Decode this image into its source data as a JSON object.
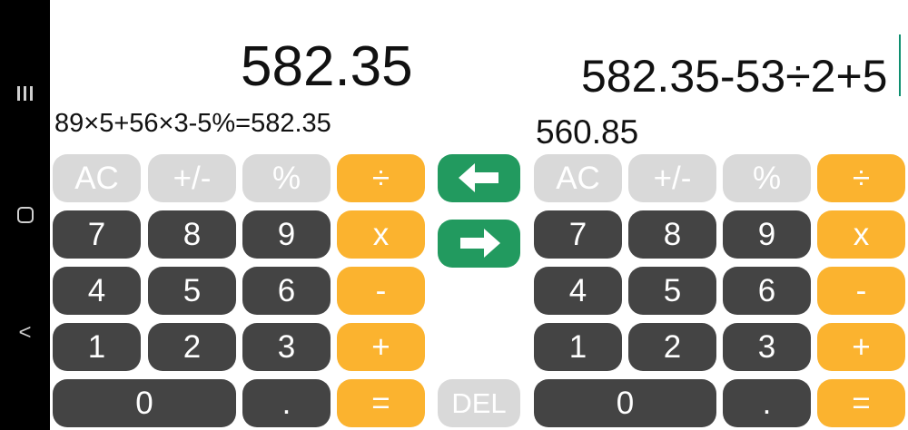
{
  "left_panel": {
    "display": "582.35",
    "history": "89×5+56×3-5%=582.35",
    "keys": {
      "ac": "AC",
      "plusminus": "+/-",
      "percent": "%",
      "divide": "÷",
      "seven": "7",
      "eight": "8",
      "nine": "9",
      "multiply": "x",
      "four": "4",
      "five": "5",
      "six": "6",
      "minus": "-",
      "one": "1",
      "two": "2",
      "three": "3",
      "plus": "+",
      "zero": "0",
      "dot": ".",
      "equals": "="
    }
  },
  "right_panel": {
    "expression": "582.35-53÷2+5",
    "result": "560.85",
    "keys": {
      "ac": "AC",
      "plusminus": "+/-",
      "percent": "%",
      "divide": "÷",
      "seven": "7",
      "eight": "8",
      "nine": "9",
      "multiply": "x",
      "four": "4",
      "five": "5",
      "six": "6",
      "minus": "-",
      "one": "1",
      "two": "2",
      "three": "3",
      "plus": "+",
      "zero": "0",
      "dot": ".",
      "equals": "="
    }
  },
  "middle": {
    "copy_left_icon": "arrow-left-icon",
    "copy_right_icon": "arrow-right-icon",
    "del_label": "DEL"
  },
  "colors": {
    "function_key": "#d9d9d9",
    "digit_key": "#444444",
    "operator_key": "#fbb32f",
    "arrow_key": "#229a5f",
    "cursor": "#0f8f70"
  },
  "nav": {
    "recents_icon": "recents-icon",
    "home_icon": "home-icon",
    "back_icon": "back-icon"
  }
}
